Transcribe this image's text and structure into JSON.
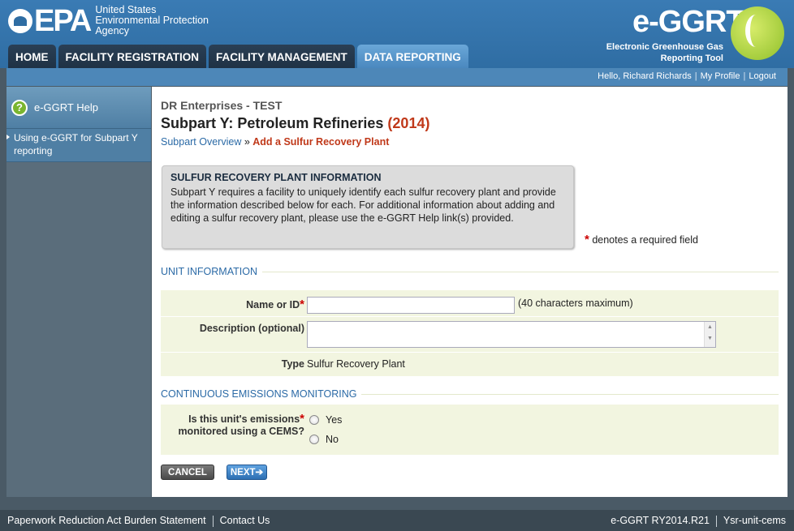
{
  "header": {
    "epa_text": "EPA",
    "agency_line1": "United States",
    "agency_line2": "Environmental Protection",
    "agency_line3": "Agency",
    "ggrt_title": "e-GGRT",
    "ggrt_sub1": "Electronic Greenhouse Gas",
    "ggrt_sub2": "Reporting Tool"
  },
  "nav": {
    "tabs": [
      {
        "label": "HOME"
      },
      {
        "label": "FACILITY REGISTRATION"
      },
      {
        "label": "FACILITY MANAGEMENT"
      },
      {
        "label": "DATA REPORTING"
      }
    ]
  },
  "userbar": {
    "greeting": "Hello, Richard Richards",
    "profile": "My Profile",
    "logout": "Logout"
  },
  "sidebar": {
    "help_label": "e-GGRT Help",
    "help_link": "Using e-GGRT for Subpart Y reporting"
  },
  "main": {
    "org": "DR Enterprises - TEST",
    "title": "Subpart Y: Petroleum Refineries",
    "year": "(2014)",
    "crumb_link": "Subpart Overview",
    "crumb_sep": " » ",
    "crumb_current": "Add a Sulfur Recovery Plant",
    "info_title": "SULFUR RECOVERY PLANT INFORMATION",
    "info_text": "Subpart Y requires a facility to uniquely identify each sulfur recovery plant and provide the information described below for each. For additional information about adding and editing a sulfur recovery plant, please use the e-GGRT Help link(s) provided.",
    "required_star": "*",
    "required_note": "denotes a required field"
  },
  "unit_info": {
    "heading": "UNIT INFORMATION",
    "name_label": "Name or ID",
    "name_value": "",
    "name_hint": "(40 characters maximum)",
    "desc_label": "Description (optional)",
    "desc_value": "",
    "type_label": "Type",
    "type_value": "Sulfur Recovery Plant"
  },
  "cems": {
    "heading": "CONTINUOUS EMISSIONS MONITORING",
    "question_line1": "Is this unit's emissions",
    "question_line2": "monitored using a CEMS?",
    "options": [
      {
        "label": "Yes"
      },
      {
        "label": "No"
      }
    ]
  },
  "buttons": {
    "cancel": "CANCEL",
    "next": "NEXT"
  },
  "footer": {
    "paperwork": "Paperwork Reduction Act Burden Statement",
    "contact": "Contact Us",
    "version": "e-GGRT RY2014.R21",
    "page_id": "Ysr-unit-cems"
  },
  "colors": {
    "header_blue": "#2f6da3",
    "active_tab": "#4a88bf",
    "accent_red": "#c0391a",
    "link_blue": "#2b6aa6",
    "row_bg": "#f2f5e0"
  }
}
